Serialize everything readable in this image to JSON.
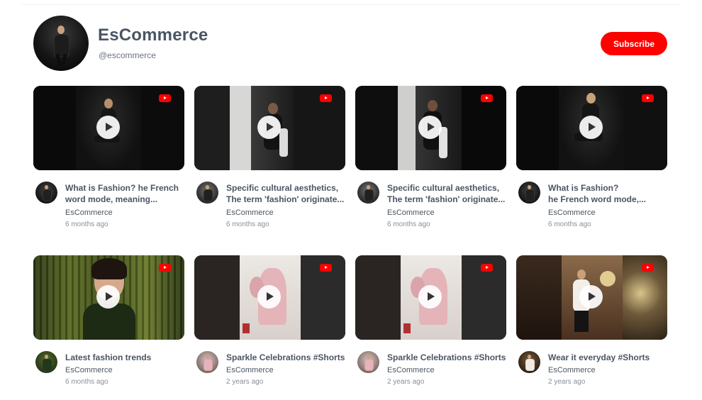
{
  "channel": {
    "name": "EsCommerce",
    "handle": "@escommerce",
    "subscribe_label": "Subscribe"
  },
  "colors": {
    "accent": "#ff0000",
    "text": "#4b5563",
    "muted": "#8a8f98"
  },
  "videos": [
    {
      "title": "What is Fashion? he French\nword mode, meaning...",
      "channel": "EsCommerce",
      "age": "6 months ago"
    },
    {
      "title": "Specific cultural aesthetics,\nThe term 'fashion' originate...",
      "channel": "EsCommerce",
      "age": "6 months ago"
    },
    {
      "title": "Specific cultural aesthetics,\nThe term 'fashion' originate...",
      "channel": "EsCommerce",
      "age": "6 months ago"
    },
    {
      "title": "What is Fashion?\nhe French word mode,...",
      "channel": "EsCommerce",
      "age": "6 months ago"
    },
    {
      "title": "Latest fashion trends",
      "channel": "EsCommerce",
      "age": "6 months ago"
    },
    {
      "title": "Sparkle Celebrations #Shorts",
      "channel": "EsCommerce",
      "age": "2 years ago"
    },
    {
      "title": "Sparkle Celebrations #Shorts",
      "channel": "EsCommerce",
      "age": "2 years ago"
    },
    {
      "title": "Wear it everyday #Shorts",
      "channel": "EsCommerce",
      "age": "2 years ago"
    }
  ],
  "icons": {
    "play": "play-icon",
    "youtube": "youtube-logo-icon"
  }
}
